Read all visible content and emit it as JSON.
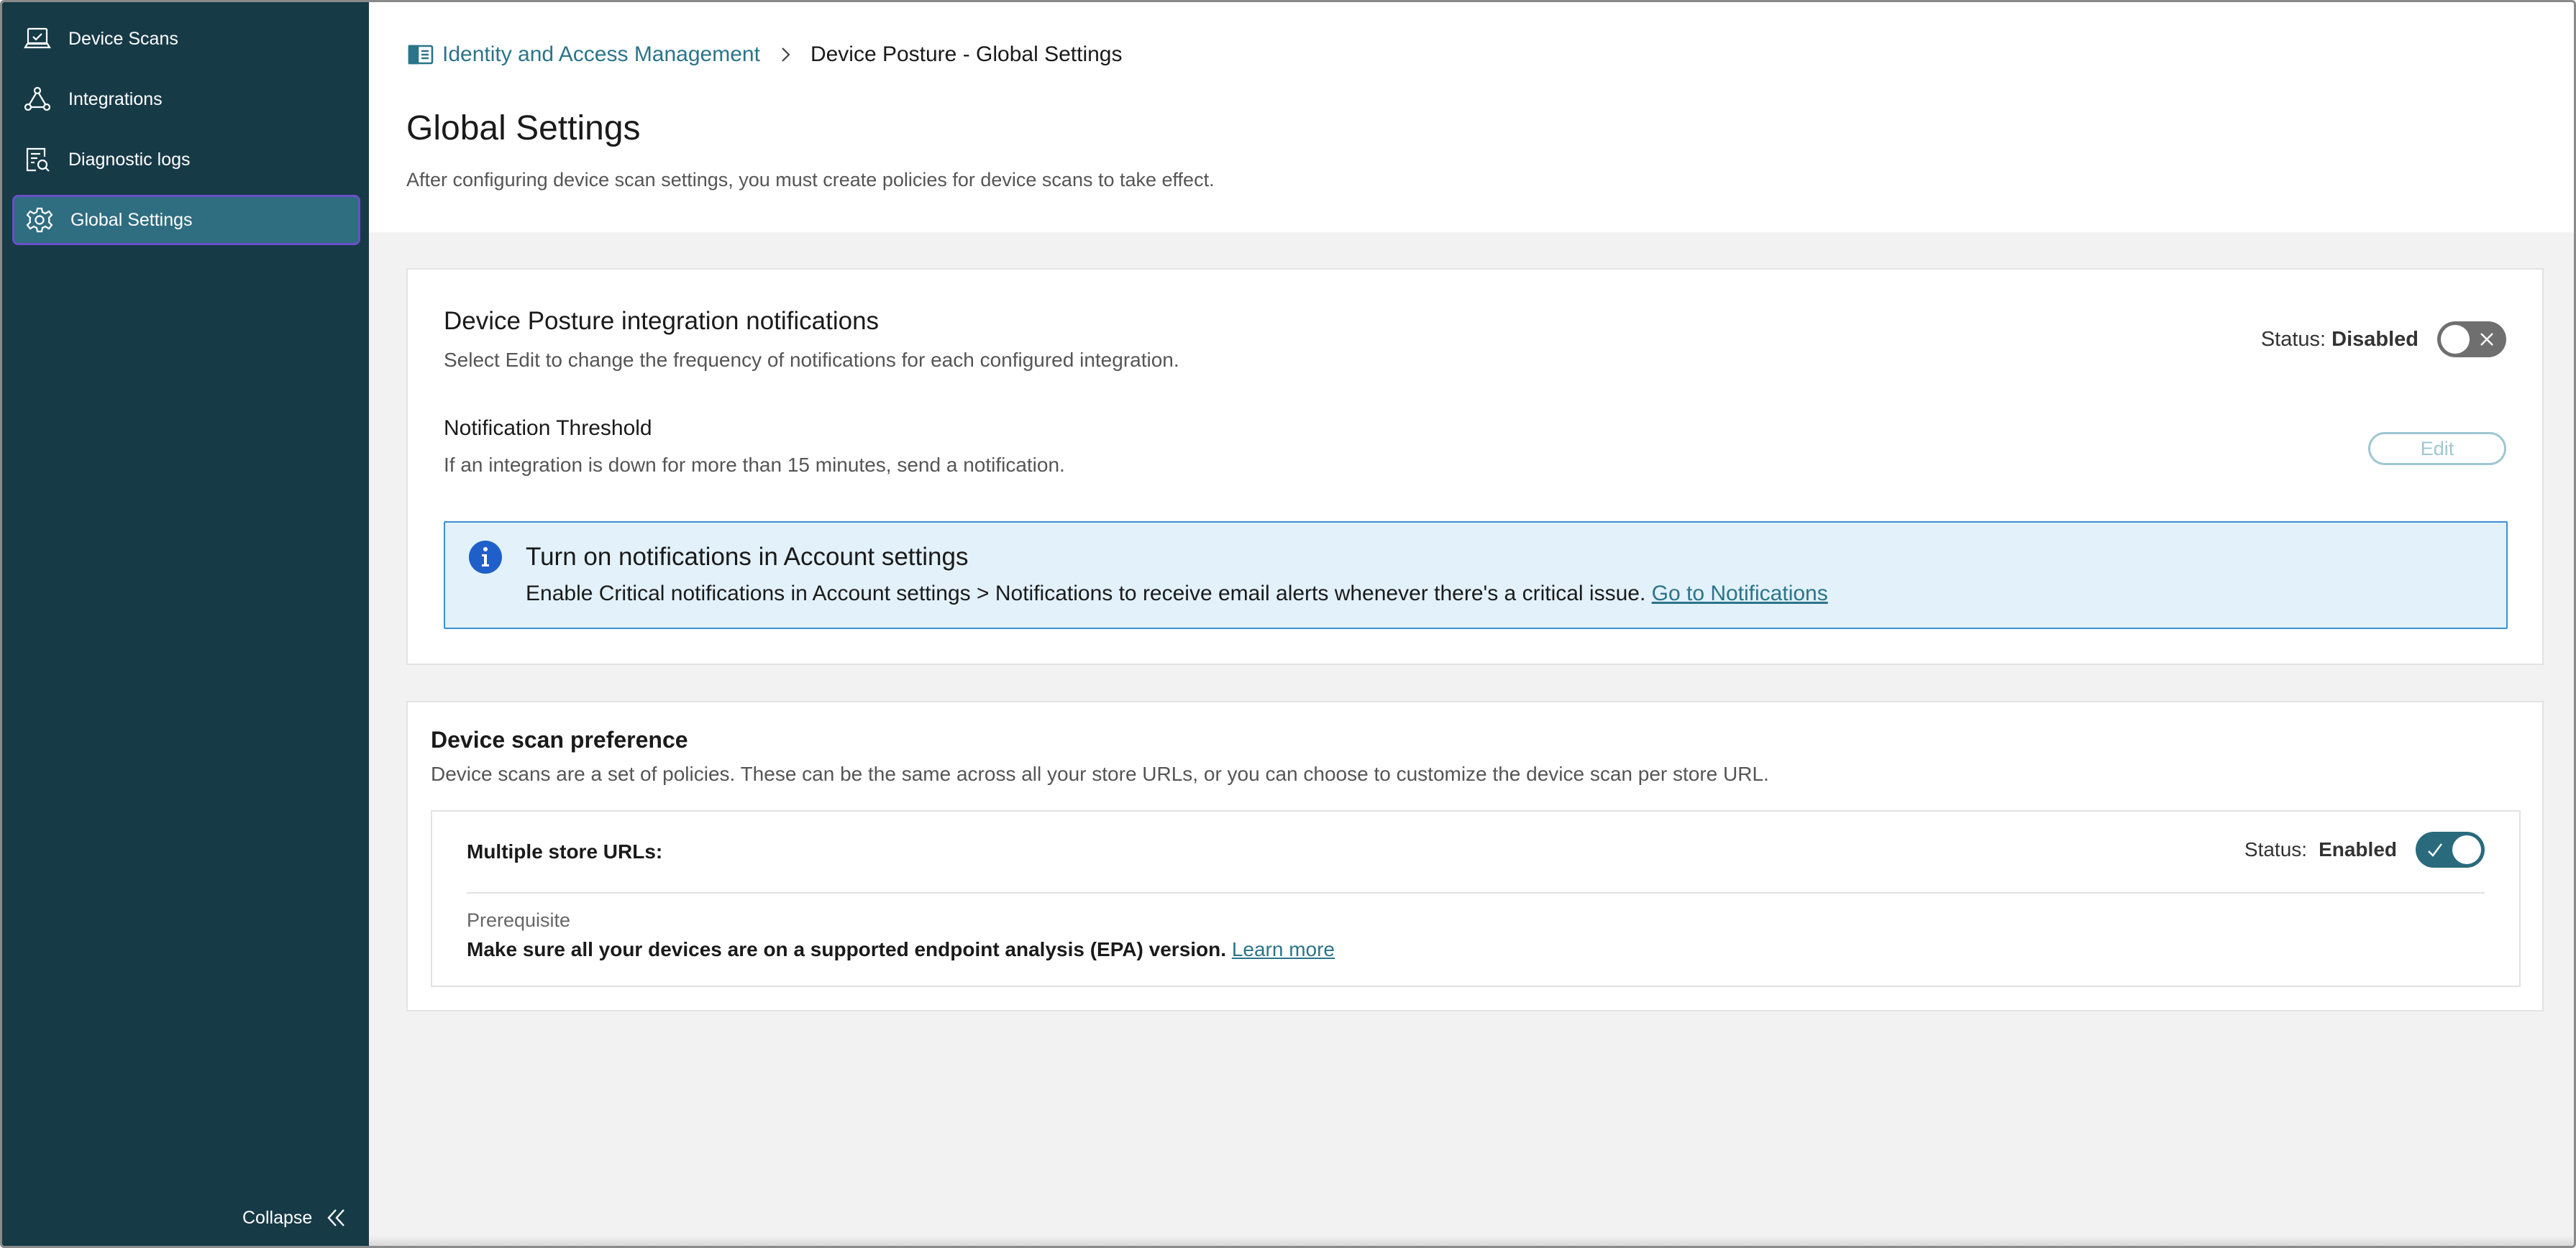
{
  "sidebar": {
    "items": [
      {
        "label": "Device Scans",
        "icon": "laptop-check-icon"
      },
      {
        "label": "Integrations",
        "icon": "network-nodes-icon"
      },
      {
        "label": "Diagnostic logs",
        "icon": "log-search-icon"
      },
      {
        "label": "Global Settings",
        "icon": "gear-icon",
        "active": true
      }
    ],
    "collapse_label": "Collapse"
  },
  "header": {
    "breadcrumb": {
      "root": "Identity and Access Management",
      "current": "Device Posture - Global Settings"
    },
    "title": "Global Settings",
    "subtitle": "After configuring device scan settings, you must create policies for device scans to take effect."
  },
  "notifications_card": {
    "title": "Device Posture integration notifications",
    "description": "Select Edit to change the frequency of notifications for each configured integration.",
    "status_label": "Status:",
    "status_value": "Disabled",
    "threshold_title": "Notification Threshold",
    "threshold_description": "If an integration is down for more than 15 minutes, send a notification.",
    "edit_label": "Edit",
    "info": {
      "title": "Turn on notifications in Account settings",
      "text": "Enable Critical notifications in Account settings > Notifications to receive email alerts whenever there's a critical issue. ",
      "link": "Go to Notifications"
    }
  },
  "scan_card": {
    "title": "Device scan preference",
    "description": "Device scans are a set of policies. These can be the same across all your store URLs, or you can choose to customize the device scan per store URL.",
    "option_label": "Multiple store URLs:",
    "status_label": "Status:",
    "status_value": "Enabled",
    "prereq_label": "Prerequisite",
    "prereq_text": "Make sure all your devices are on a supported endpoint analysis (EPA) version. ",
    "prereq_link": "Learn more"
  },
  "colors": {
    "sidebar_bg": "#173a47",
    "active_item": "#2f6d80",
    "link": "#2b7489",
    "toggle_on": "#2a6a7d",
    "toggle_off": "#6f6f6f",
    "info_bg": "#e3f1fb",
    "info_border": "#3d8fd4"
  }
}
